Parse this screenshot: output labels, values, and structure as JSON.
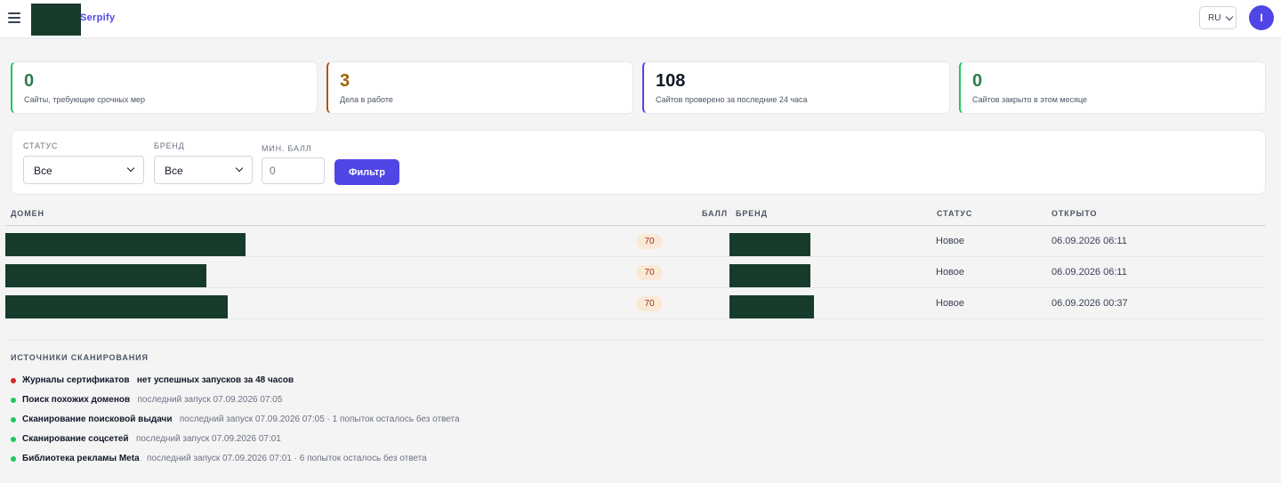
{
  "header": {
    "brand": "Serpify",
    "lang": "RU",
    "avatar_initial": "I"
  },
  "stats": [
    {
      "value": "0",
      "label": "Сайты, требующие срочных мер",
      "color": "#2f7d4f"
    },
    {
      "value": "3",
      "label": "Дела в работе",
      "color": "#a16207"
    },
    {
      "value": "108",
      "label": "Сайтов проверено за последние 24 часа",
      "color": "#111827"
    },
    {
      "value": "0",
      "label": "Сайтов закрыто в этом месяце",
      "color": "#2f7d4f"
    }
  ],
  "filters": {
    "status_label": "СТАТУС",
    "status_value": "Все",
    "brand_label": "БРЕНД",
    "brand_value": "Все",
    "min_score_label": "МИН. БАЛЛ",
    "min_score_placeholder": "0",
    "button": "Фильтр"
  },
  "table": {
    "headers": {
      "domain": "ДОМЕН",
      "score": "БАЛЛ",
      "brand": "БРЕНД",
      "status": "СТАТУС",
      "opened": "ОТКРЫТО"
    },
    "rows": [
      {
        "score": "70",
        "status": "Новое",
        "opened": "06.09.2026 06:11"
      },
      {
        "score": "70",
        "status": "Новое",
        "opened": "06.09.2026 06:11"
      },
      {
        "score": "70",
        "status": "Новое",
        "opened": "06.09.2026 00:37"
      }
    ]
  },
  "sources": {
    "title": "ИСТОЧНИКИ СКАНИРОВАНИЯ",
    "items": [
      {
        "name": "Журналы сертификатов",
        "info": "нет успешных запусков за 48 часов",
        "status_color": "#dc2626"
      },
      {
        "name": "Поиск похожих доменов",
        "info": "последний запуск 07.09.2026 07:05",
        "status_color": "#22c55e"
      },
      {
        "name": "Сканирование поисковой выдачи",
        "info": "последний запуск 07.09.2026 07:05 · 1 попыток осталось без ответа",
        "status_color": "#22c55e"
      },
      {
        "name": "Сканирование соцсетей",
        "info": "последний запуск 07.09.2026 07:01",
        "status_color": "#22c55e"
      },
      {
        "name": "Библиотека рекламы Meta",
        "info": "последний запуск 07.09.2026 07:01 · 6 попыток осталось без ответа",
        "status_color": "#22c55e"
      }
    ]
  }
}
